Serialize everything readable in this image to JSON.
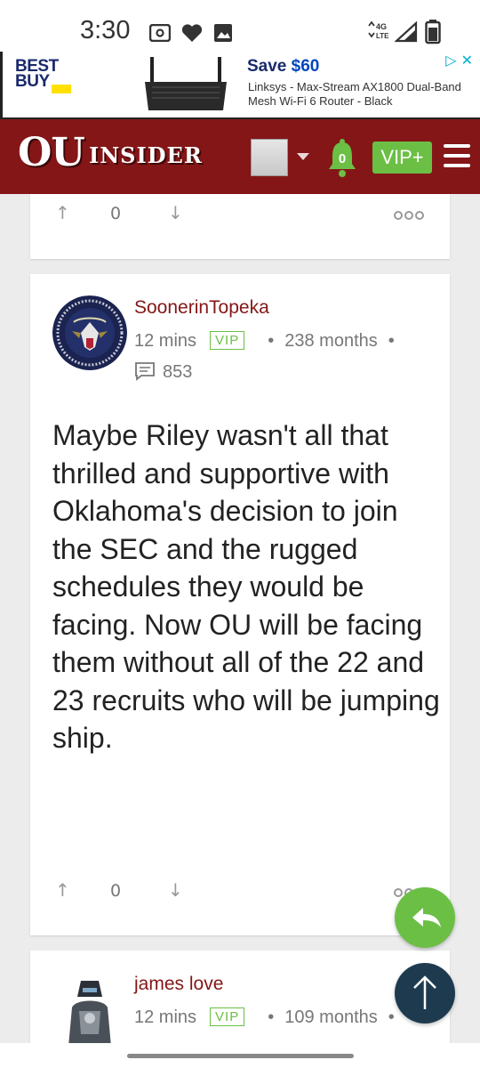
{
  "status_bar": {
    "time": "3:30",
    "network": "4G LTE",
    "icons": [
      "cast-icon",
      "heart-icon",
      "image-icon",
      "signal-icon",
      "battery-icon"
    ]
  },
  "ad": {
    "brand": [
      "BEST",
      "BUY"
    ],
    "headline_prefix": "Save ",
    "headline_amount": "$60",
    "description": "Linksys - Max-Stream AX1800 Dual-Band Mesh Wi-Fi 6 Router - Black",
    "choices_icon": "ad-choices-icon"
  },
  "header": {
    "logo_ou": "OU",
    "logo_insider": "INSIDER",
    "notifications": "0",
    "vip_label": "VIP+",
    "colors": {
      "primary": "#841617",
      "vip": "#6bbf45"
    }
  },
  "prev_post": {
    "votes": "0"
  },
  "post": {
    "author": "SoonerinTopeka",
    "time": "12 mins",
    "badge": "VIP",
    "tenure": "238 months",
    "post_count": "853",
    "body": "Maybe Riley wasn't all that thrilled and supportive with Oklahoma's decision to join the SEC and the rugged schedules they would be facing. Now OU will be facing them without all of the 22 and 23 recruits who will be jumping ship.",
    "votes": "0"
  },
  "next_post": {
    "author": "james love",
    "time": "12 mins",
    "badge": "VIP",
    "tenure": "109 months"
  }
}
